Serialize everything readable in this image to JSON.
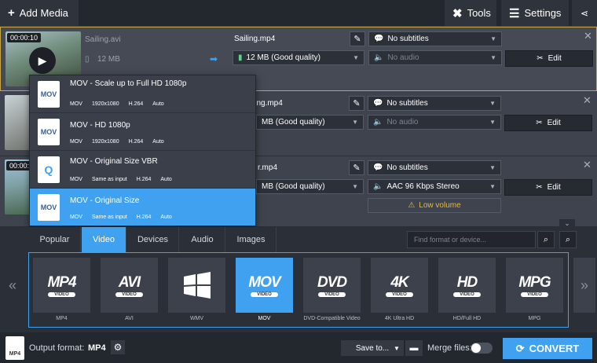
{
  "topbar": {
    "add_media": "Add Media",
    "tools": "Tools",
    "settings": "Settings"
  },
  "rows": [
    {
      "timecode": "00:00:10",
      "filename": "Sailing.avi",
      "in_size": "12 MB",
      "out_name": "Sailing.mp4",
      "out_size": "12 MB (Good quality)",
      "subtitles": "No subtitles",
      "audio": "No audio",
      "edit": "Edit"
    },
    {
      "out_name": "ling.mp4",
      "out_size": "MB (Good quality)",
      "subtitles": "No subtitles",
      "audio": "No audio",
      "edit": "Edit"
    },
    {
      "timecode": "00:00:10",
      "out_name": "r.mp4",
      "out_size": "MB (Good quality)",
      "subtitles": "No subtitles",
      "audio": "AAC 96 Kbps Stereo",
      "edit": "Edit",
      "warning": "Low volume"
    }
  ],
  "dropdown": [
    {
      "icon": "MOV",
      "title": "MOV - Scale up to Full HD 1080p",
      "meta": [
        "MOV",
        "1920x1080",
        "H.264",
        "Auto"
      ]
    },
    {
      "icon": "MOV",
      "title": "MOV - HD 1080p",
      "meta": [
        "MOV",
        "1920x1080",
        "H.264",
        "Auto"
      ]
    },
    {
      "icon": "Q",
      "title": "MOV - Original Size VBR",
      "meta": [
        "MOV",
        "Same as input",
        "H.264",
        "Auto"
      ]
    },
    {
      "icon": "MOV",
      "title": "MOV - Original Size",
      "meta": [
        "MOV",
        "Same as input",
        "H.264",
        "Auto"
      ]
    }
  ],
  "tabs": [
    "Popular",
    "Video",
    "Devices",
    "Audio",
    "Images"
  ],
  "search": {
    "placeholder": "Find format or device..."
  },
  "formats": [
    {
      "big": "MP4",
      "sub": "VIDEO",
      "label": "MP4"
    },
    {
      "big": "AVI",
      "sub": "VIDEO",
      "label": "AVI"
    },
    {
      "big": "",
      "sub": "",
      "label": "WMV"
    },
    {
      "big": "MOV",
      "sub": "VIDEO",
      "label": "MOV"
    },
    {
      "big": "DVD",
      "sub": "VIDEO",
      "label": "DVD-Compatible Video"
    },
    {
      "big": "4K",
      "sub": "VIDEO",
      "label": "4K Ultra HD"
    },
    {
      "big": "HD",
      "sub": "VIDEO",
      "label": "HD/Full HD"
    },
    {
      "big": "MPG",
      "sub": "VIDEO",
      "label": "MPG"
    }
  ],
  "bottom": {
    "output_label": "Output format:",
    "output_value": "MP4",
    "save_to": "Save to...",
    "merge": "Merge files:",
    "convert": "CONVERT"
  },
  "colors": {
    "accent": "#3fa1f0",
    "selected_border": "#c6a84b"
  }
}
